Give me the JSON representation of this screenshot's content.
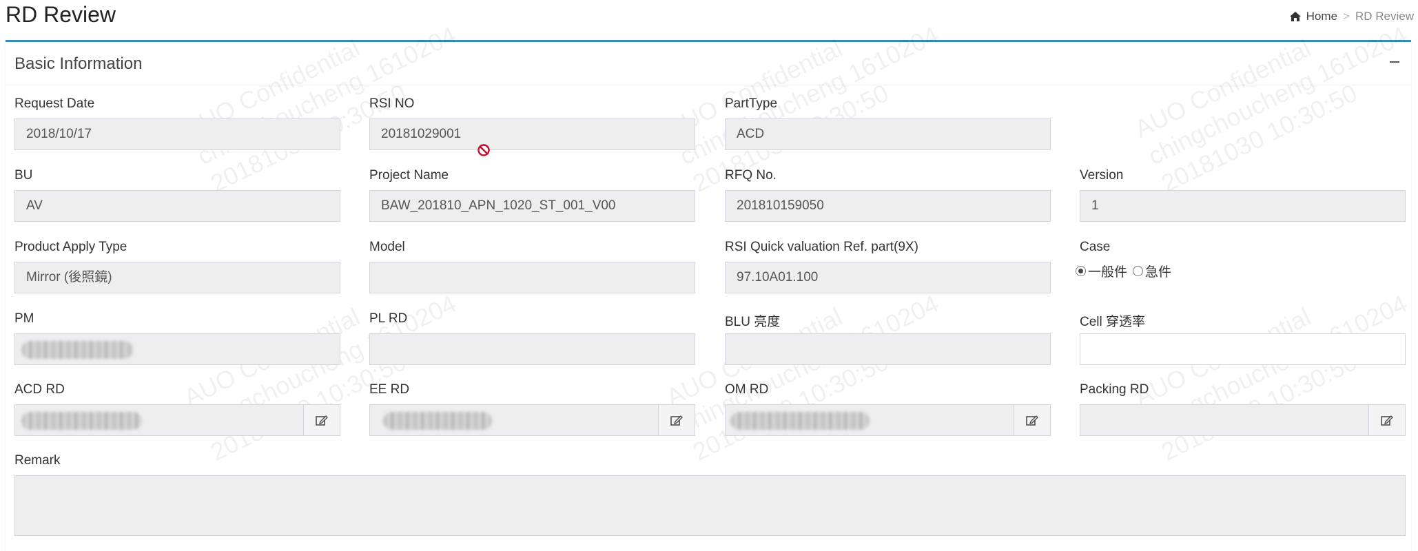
{
  "page": {
    "title": "RD Review",
    "breadcrumb": {
      "home": "Home",
      "separator": ">",
      "current": "RD Review"
    }
  },
  "panel": {
    "title": "Basic Information",
    "fields": {
      "request_date": {
        "label": "Request Date",
        "value": "2018/10/17"
      },
      "rsi_no": {
        "label": "RSI NO",
        "value": "20181029001"
      },
      "part_type": {
        "label": "PartType",
        "value": "ACD"
      },
      "bu": {
        "label": "BU",
        "value": "AV"
      },
      "project_name": {
        "label": "Project Name",
        "value": "BAW_201810_APN_1020_ST_001_V00"
      },
      "rfq_no": {
        "label": "RFQ No.",
        "value": "201810159050"
      },
      "version": {
        "label": "Version",
        "value": "1"
      },
      "product_apply_type": {
        "label": "Product Apply Type",
        "value": "Mirror (後照鏡)"
      },
      "model": {
        "label": "Model",
        "value": ""
      },
      "rsi_quick_ref": {
        "label": "RSI Quick valuation Ref. part(9X)",
        "value": "97.10A01.100"
      },
      "case": {
        "label": "Case",
        "options": [
          "一般件",
          "急件"
        ],
        "selected": "一般件"
      },
      "pm": {
        "label": "PM",
        "value": ""
      },
      "pl_rd": {
        "label": "PL RD",
        "value": ""
      },
      "blu": {
        "label": "BLU 亮度",
        "value": ""
      },
      "cell": {
        "label": "Cell 穿透率",
        "value": ""
      },
      "acd_rd": {
        "label": "ACD RD",
        "value": ""
      },
      "ee_rd": {
        "label": "EE RD",
        "value": ""
      },
      "om_rd": {
        "label": "OM RD",
        "value": ""
      },
      "packing_rd": {
        "label": "Packing RD",
        "value": ""
      },
      "remark": {
        "label": "Remark",
        "value": ""
      }
    }
  },
  "watermark": {
    "line1": "AUO Confidential",
    "line2": "chingchoucheng 1610204",
    "line3": "20181030 10:30:50"
  },
  "icons": {
    "home": "home-icon",
    "collapse": "minus-icon",
    "edit": "edit-icon",
    "cursor": "not-allowed-cursor-icon"
  },
  "colors": {
    "accent": "#3c8dbc",
    "input_readonly_bg": "#eeeeee",
    "input_border": "#d2d6de"
  }
}
